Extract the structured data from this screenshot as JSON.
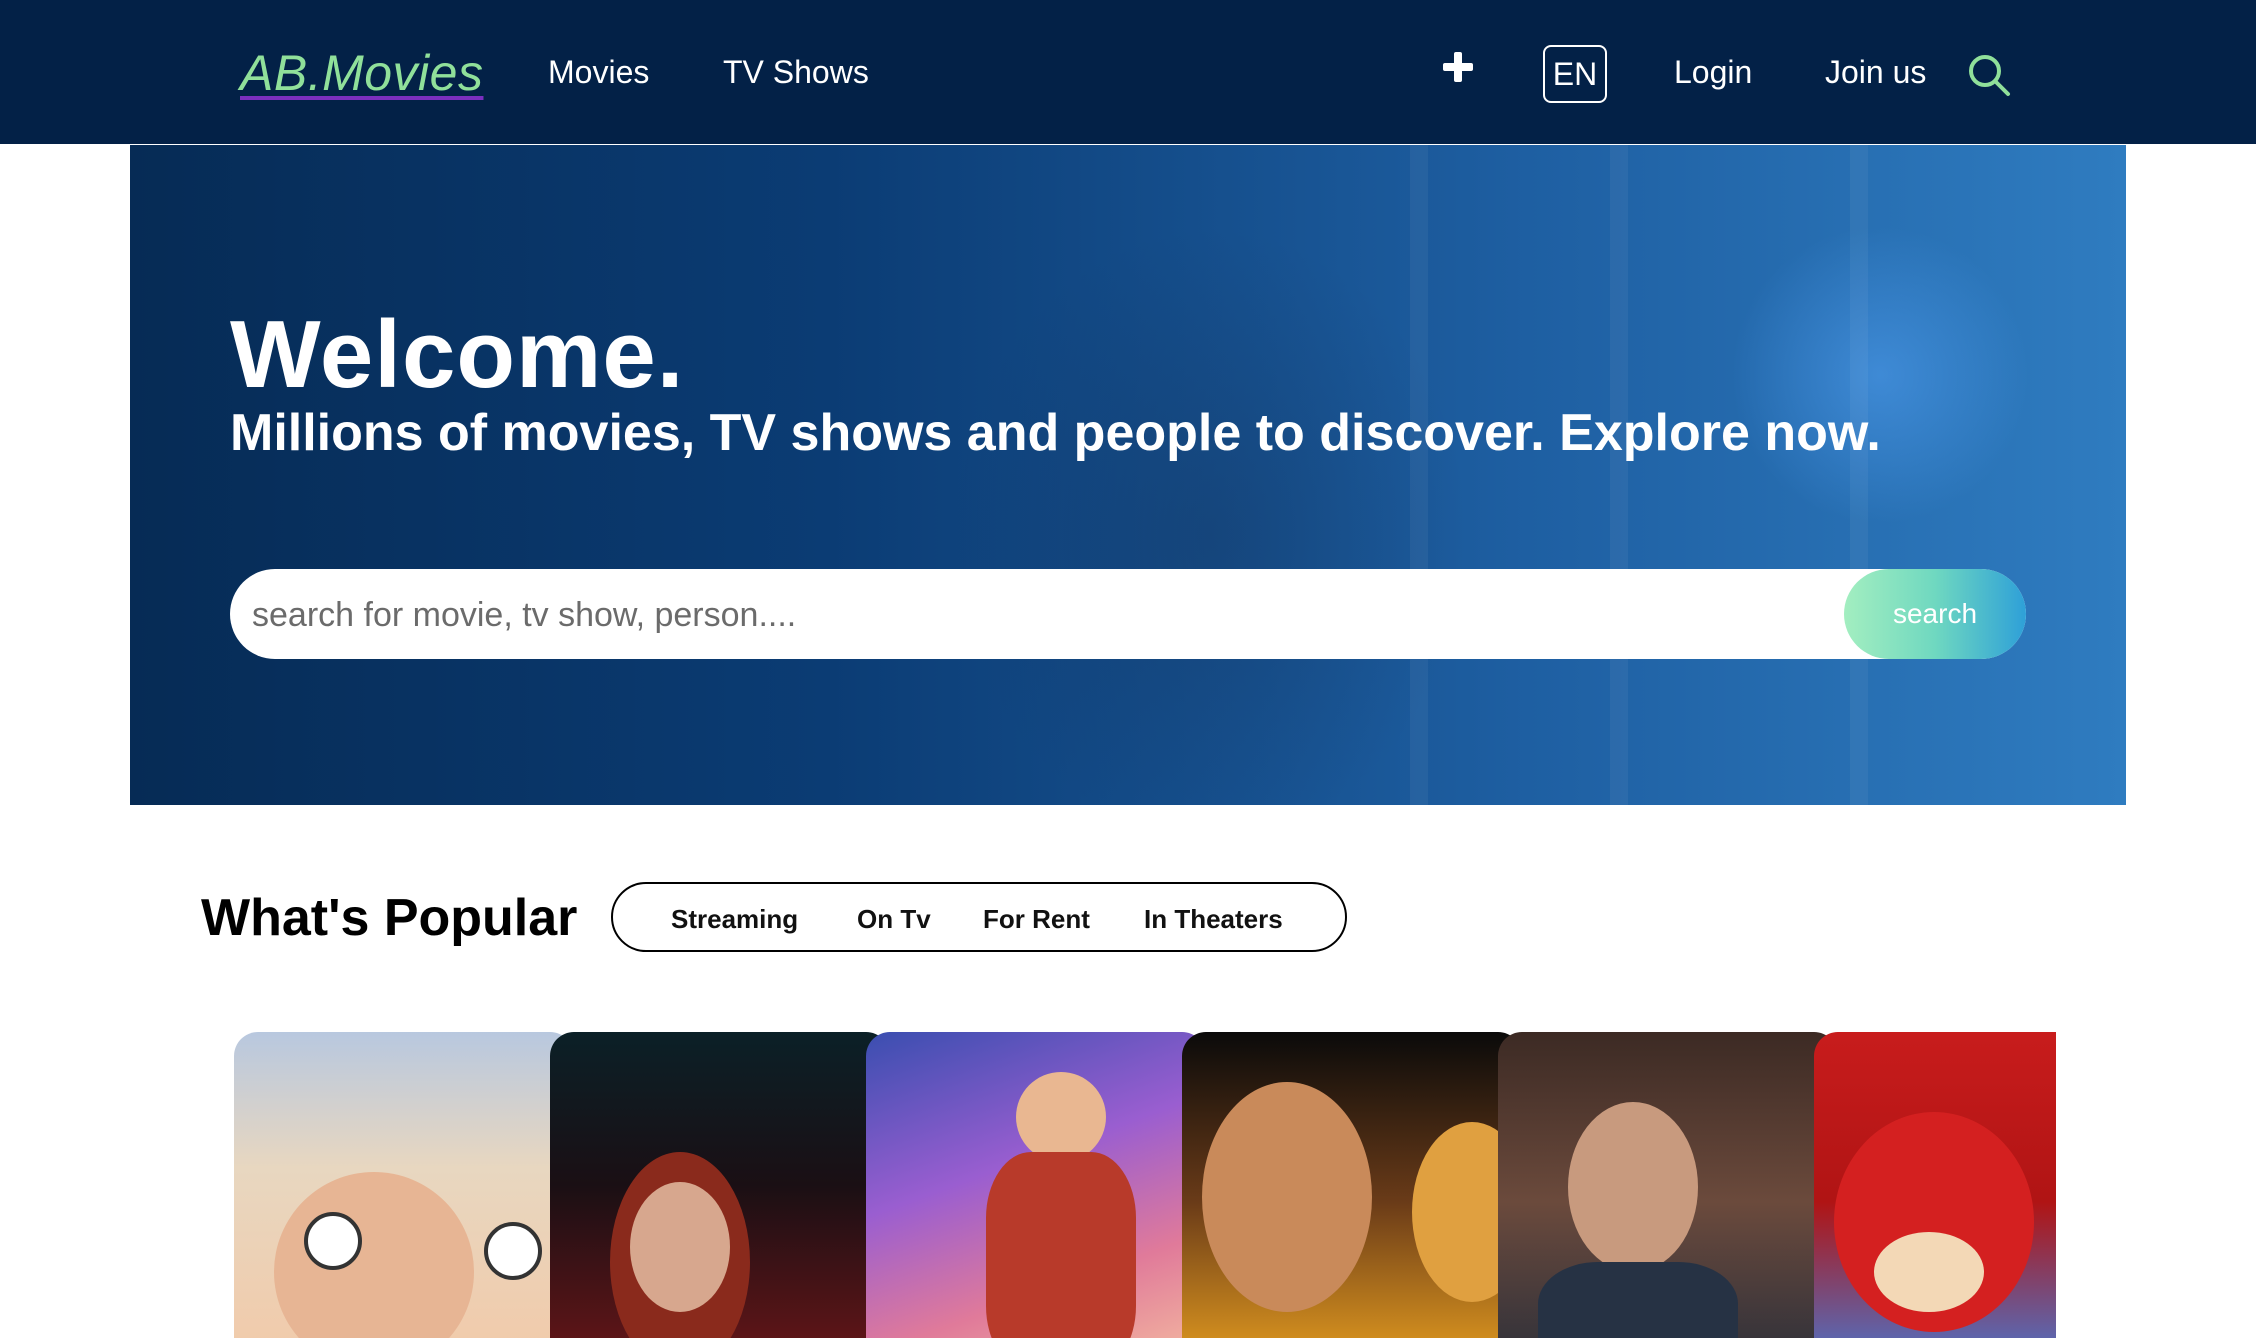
{
  "header": {
    "logo": "AB.Movies",
    "nav": [
      "Movies",
      "TV Shows"
    ],
    "language": "EN",
    "login": "Login",
    "join": "Join us"
  },
  "hero": {
    "title": "Welcome.",
    "subtitle": "Millions of movies, TV shows and people to discover. Explore now.",
    "search_placeholder": "search for movie, tv show, person....",
    "search_button": "search"
  },
  "popular": {
    "title": "What's Popular",
    "tabs": [
      "Streaming",
      "On Tv",
      "For Rent",
      "In Theaters"
    ],
    "poster_count": 6
  },
  "colors": {
    "header_bg": "#032147",
    "logo": "#90e09a",
    "accent": "#6fd8c0"
  },
  "icons": [
    "plus-icon",
    "search-icon"
  ]
}
